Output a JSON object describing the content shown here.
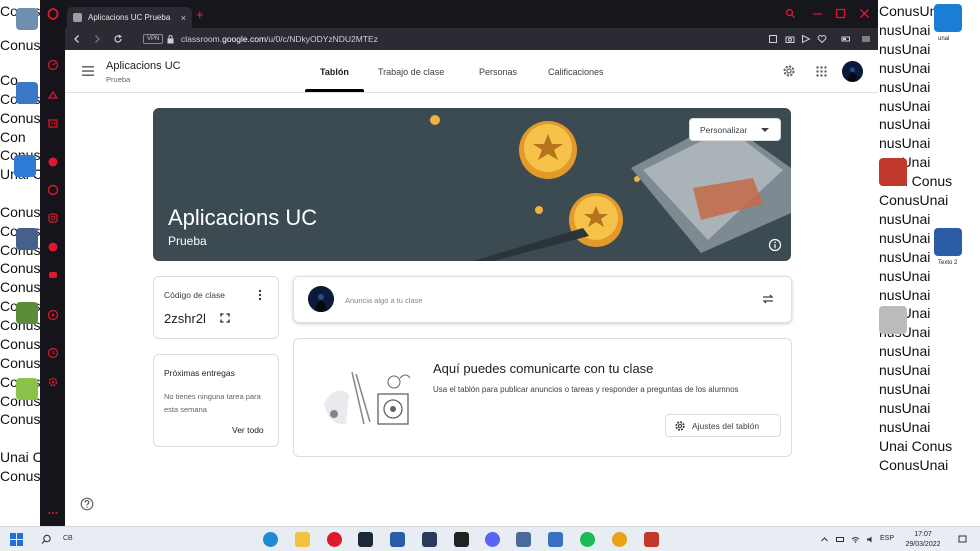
{
  "desktop": {
    "bg_left": [
      "Conus",
      "Conus",
      "Co",
      "Conus",
      "Conus",
      "Con",
      "Conus",
      "Unai C",
      "Conus",
      "Conus",
      "Conus",
      "Conus",
      "Conus",
      "Conus",
      "Conus",
      "Conus",
      "Conus",
      "Conus",
      "Conus",
      "Conus",
      "Unai C",
      "Conus"
    ],
    "bg_right": [
      "ConusUnai",
      "nusUnai",
      "nusUnai",
      "nusUnai",
      "nusUnai",
      "nusUnai",
      "nusUnai",
      "nusUnai",
      "nusUnai",
      "Unai Conus",
      "ConusUnai",
      "nusUnai",
      "nusUnai",
      "nusUnai",
      "nusUnai",
      "nusUnai",
      "nusUnai",
      "nusUnai",
      "nusUnai",
      "nusUnai",
      "nusUnai",
      "nusUnai",
      "nusUnai",
      "Unai Conus",
      "ConusUnai"
    ],
    "right_icons": [
      {
        "label": "unai",
        "color": "#1a7fd4"
      },
      {
        "label": "",
        "color": "#c0392b"
      },
      {
        "label": "Texto 2",
        "color": "#2b5ca8"
      },
      {
        "label": "",
        "color": "#bbbbbb"
      }
    ],
    "left_icons": [
      {
        "label": "",
        "color": "#6e8fb0"
      },
      {
        "label": "",
        "color": "#3a78c8"
      },
      {
        "label": "",
        "color": "#2c7cd6"
      },
      {
        "label": "",
        "color": "#46608c"
      },
      {
        "label": "",
        "color": "#5b8c3a"
      },
      {
        "label": "",
        "color": "#8bc34a"
      }
    ]
  },
  "browser": {
    "tab_title": "Aplicacions UC Prueba",
    "vpn": "VPN",
    "url_prefix": "classroom.",
    "url_domain": "google.com",
    "url_path": "/u/0/c/NDkyODYzNDU2MTEz"
  },
  "classroom": {
    "class_name": "Aplicacions UC",
    "class_section": "Prueba",
    "tabs": [
      {
        "label": "Tablón",
        "active": true
      },
      {
        "label": "Trabajo de clase",
        "active": false
      },
      {
        "label": "Personas",
        "active": false
      },
      {
        "label": "Calificaciones",
        "active": false
      }
    ],
    "banner": {
      "title": "Aplicacions UC",
      "subtitle": "Prueba",
      "customize_label": "Personalizar"
    },
    "class_code": {
      "label": "Código de clase",
      "value": "2zshr2l"
    },
    "upcoming": {
      "title": "Próximas entregas",
      "empty_text": "No tienes ninguna tarea para esta semana",
      "view_all": "Ver todo"
    },
    "announce_placeholder": "Anuncia algo a tu clase",
    "stream": {
      "heading": "Aquí puedes comunicarte con tu clase",
      "description": "Usa el tablón para publicar anuncios o tareas y responder a preguntas de los alumnos",
      "settings_button": "Ajustes del tablón"
    }
  },
  "taskbar": {
    "search_text": "CB",
    "language": "ESP",
    "time": "17:07",
    "date": "29/03/2022",
    "apps": [
      {
        "name": "edge",
        "color": "#1f8ad6"
      },
      {
        "name": "file-explorer",
        "color": "#f2c23c"
      },
      {
        "name": "opera",
        "color": "#e0182d"
      },
      {
        "name": "steam",
        "color": "#1b2838"
      },
      {
        "name": "word",
        "color": "#2b5ca8"
      },
      {
        "name": "app-dark",
        "color": "#2a3a5a"
      },
      {
        "name": "epic-games",
        "color": "#222222"
      },
      {
        "name": "discord",
        "color": "#5865f2"
      },
      {
        "name": "virtualbox",
        "color": "#4a6a9a"
      },
      {
        "name": "app-blue",
        "color": "#3b6fbf"
      },
      {
        "name": "spotify",
        "color": "#1db954"
      },
      {
        "name": "chrome",
        "color": "#e8a317"
      },
      {
        "name": "app-red",
        "color": "#c0392b"
      }
    ]
  },
  "colors": {
    "opera_red": "#e0182d",
    "banner_bg": "#3c4b52",
    "coin_gold": "#f0b23c"
  }
}
